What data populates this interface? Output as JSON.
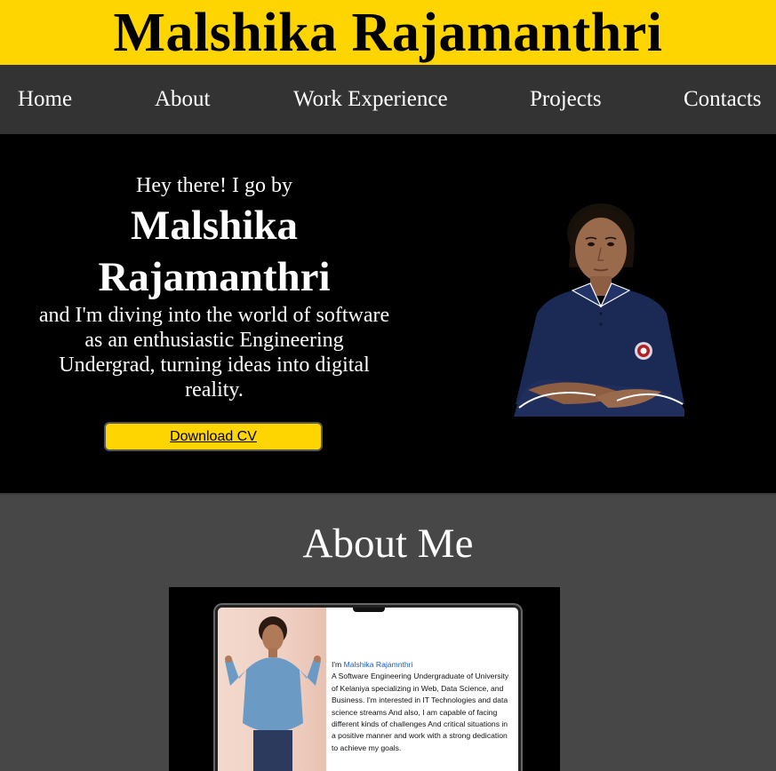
{
  "header": {
    "title": "Malshika Rajamanthri"
  },
  "nav": {
    "items": [
      {
        "label": "Home"
      },
      {
        "label": "About"
      },
      {
        "label": "Work Experience"
      },
      {
        "label": "Projects"
      },
      {
        "label": "Contacts"
      }
    ]
  },
  "hero": {
    "greeting": "Hey there! I go by",
    "name_line1": "Malshika",
    "name_line2": "Rajamanthri",
    "tagline": "and I'm diving into the world of software as an enthusiastic Engineering Undergrad, turning ideas into digital reality.",
    "cv_button": "Download CV"
  },
  "about": {
    "heading": "About Me",
    "bio_prefix": "I'm ",
    "bio_name": "Malshika Rajamnthri",
    "bio_text": "A Software Engineering Undergraduate of University of Kelaniya specializing in Web, Data Science, and Business. I'm interested in IT Technologies and data science streams And also, I am capable of facing different kinds of challenges And critical situations in a positive manner and work with a strong dedication to achieve my goals."
  },
  "colors": {
    "accent": "#FFD500",
    "nav_bg": "#333333",
    "hero_bg": "#000000",
    "about_bg": "#474747",
    "link_blue": "#1a5fd0",
    "shirt_navy": "#1b2a55"
  }
}
